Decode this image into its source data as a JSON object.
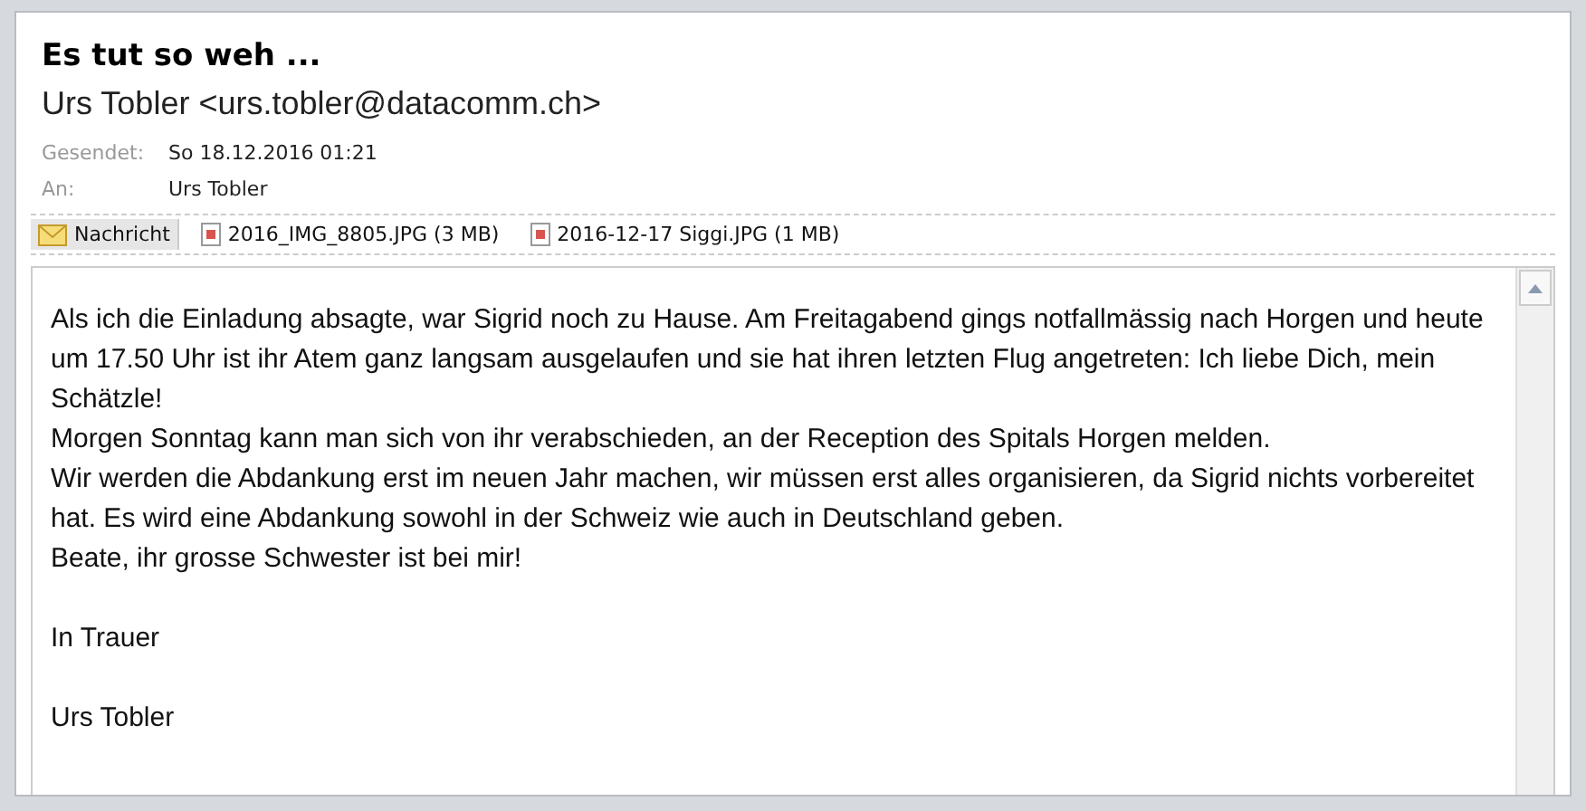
{
  "subject": "Es tut so weh ...",
  "sender": "Urs Tobler <urs.tobler@datacomm.ch>",
  "fields": [
    {
      "label": "Gesendet:",
      "value": "So 18.12.2016 01:21"
    },
    {
      "label": "An:",
      "value": "Urs Tobler"
    }
  ],
  "attachments": [
    {
      "kind": "message",
      "label": "Nachricht",
      "selected": true
    },
    {
      "kind": "file",
      "label": "2016_IMG_8805.JPG (3 MB)",
      "selected": false
    },
    {
      "kind": "file",
      "label": "2016-12-17 Siggi.JPG (1 MB)",
      "selected": false
    }
  ],
  "body": [
    "Als ich die Einladung absagte, war Sigrid noch zu Hause. Am Freitagabend gings notfallmässig nach Horgen und heute um 17.50 Uhr ist ihr Atem ganz langsam ausgelaufen und sie hat ihren letzten Flug angetreten: Ich liebe Dich, mein Schätzle!",
    "Morgen Sonntag kann man sich von ihr verabschieden, an der Reception des Spitals Horgen melden.",
    "Wir werden die Abdankung erst im neuen Jahr machen, wir müssen erst alles organisieren, da Sigrid nichts vorbereitet hat. Es wird eine Abdankung sowohl in der Schweiz wie auch in Deutschland geben.",
    "Beate, ihr grosse Schwester ist bei mir!"
  ],
  "closing": "In Trauer",
  "signature": "Urs Tobler"
}
